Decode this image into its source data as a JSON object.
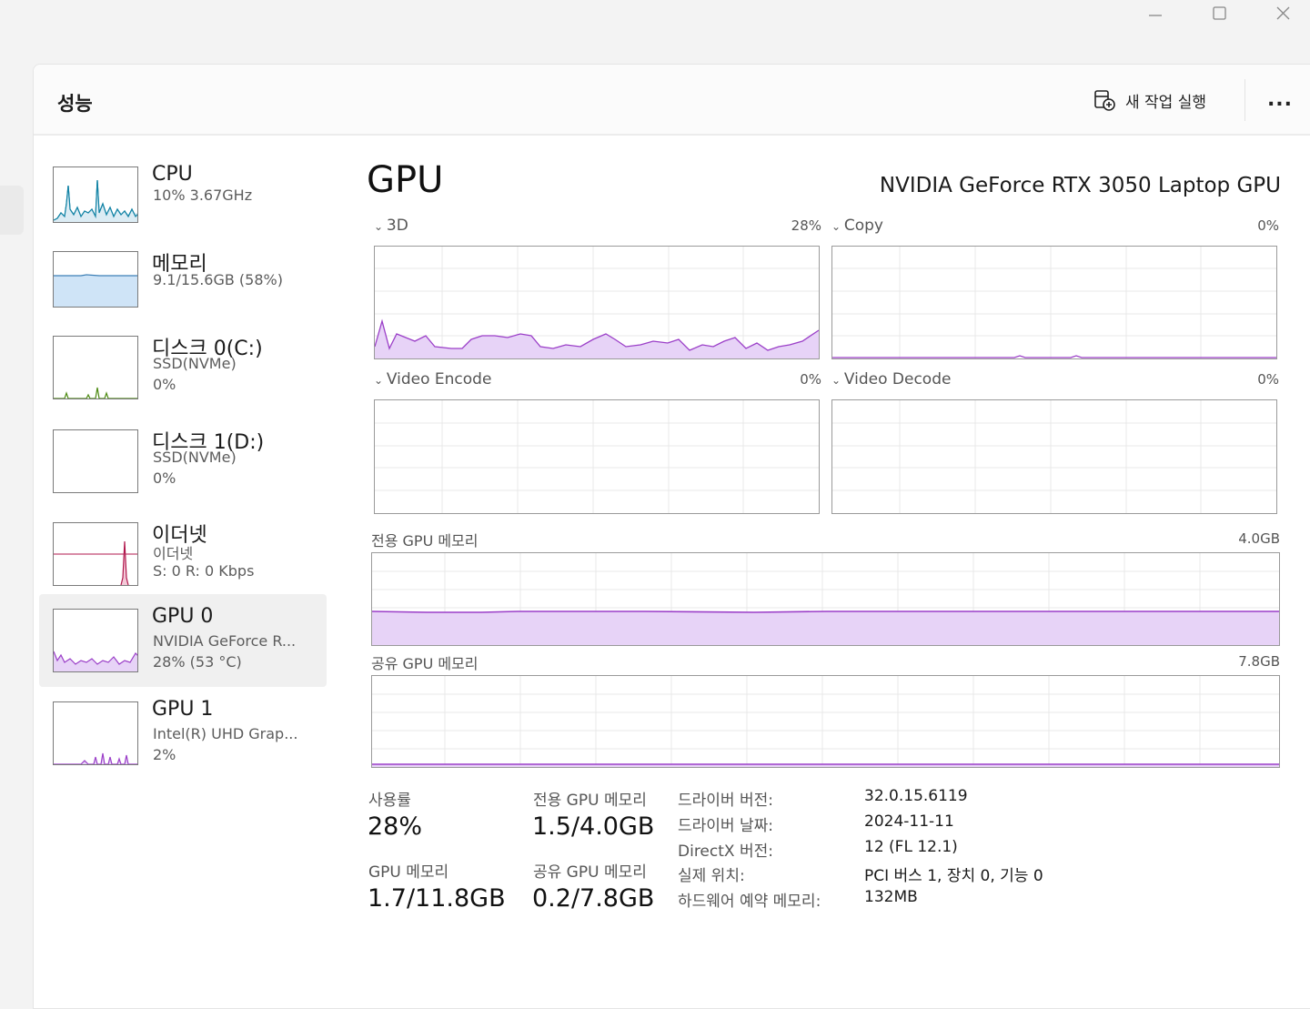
{
  "window": {
    "controls": {
      "minimize": "minimize-icon",
      "maximize": "maximize-icon",
      "close": "close-icon"
    }
  },
  "header": {
    "title": "성능",
    "run_task_label": "새 작업 실행",
    "run_task_icon": "new-task-icon",
    "more_label": "..."
  },
  "sidebar": {
    "items": [
      {
        "name": "CPU",
        "sub1": "10% 3.67GHz",
        "sub2": "",
        "sub3": ""
      },
      {
        "name": "메모리",
        "sub1": "9.1/15.6GB (58%)",
        "sub2": "",
        "sub3": ""
      },
      {
        "name": "디스크 0(C:)",
        "sub1": "SSD(NVMe)",
        "sub2": "0%",
        "sub3": ""
      },
      {
        "name": "디스크 1(D:)",
        "sub1": "SSD(NVMe)",
        "sub2": "0%",
        "sub3": ""
      },
      {
        "name": "이더넷",
        "sub1": "이더넷",
        "sub2": "S: 0 R: 0 Kbps",
        "sub3": ""
      },
      {
        "name": "GPU 0",
        "sub1": "NVIDIA GeForce R...",
        "sub2": "28% (53 °C)",
        "sub3": ""
      },
      {
        "name": "GPU 1",
        "sub1": "Intel(R) UHD Grap...",
        "sub2": "2%",
        "sub3": ""
      }
    ],
    "selected_index": 5
  },
  "main": {
    "title": "GPU",
    "model": "NVIDIA GeForce RTX 3050 Laptop GPU",
    "engines": [
      {
        "label": "3D",
        "percent": "28%"
      },
      {
        "label": "Copy",
        "percent": "0%"
      },
      {
        "label": "Video Encode",
        "percent": "0%"
      },
      {
        "label": "Video Decode",
        "percent": "0%"
      }
    ],
    "dedicated_memory": {
      "label": "전용 GPU 메모리",
      "max": "4.0GB"
    },
    "shared_memory": {
      "label": "공유 GPU 메모리",
      "max": "7.8GB"
    }
  },
  "stats": {
    "utilization_label": "사용률",
    "utilization_value": "28%",
    "dedicated_label": "전용 GPU 메모리",
    "dedicated_value": "1.5/4.0GB",
    "gpu_memory_label": "GPU 메모리",
    "gpu_memory_value": "1.7/11.8GB",
    "shared_label": "공유 GPU 메모리",
    "shared_value": "0.2/7.8GB"
  },
  "info": [
    {
      "key": "드라이버 버전:",
      "value": "32.0.15.6119"
    },
    {
      "key": "드라이버 날짜:",
      "value": "2024-11-11"
    },
    {
      "key": "DirectX 버전:",
      "value": "12 (FL 12.1)"
    },
    {
      "key": "실제 위치:",
      "value": "PCI 버스 1, 장치 0, 기능 0"
    },
    {
      "key": "하드웨어 예약 메모리:",
      "value": "132MB"
    }
  ],
  "colors": {
    "gpu_line": "#9b3fc8",
    "gpu_fill": "#e7d3f7",
    "cpu_line": "#1283a5",
    "memory_line": "#3c7fb6",
    "memory_fill": "#cfe4f7",
    "disk_line": "#4d8a12",
    "ethernet_line": "#b0174c",
    "grid": "#e8e8e8"
  }
}
